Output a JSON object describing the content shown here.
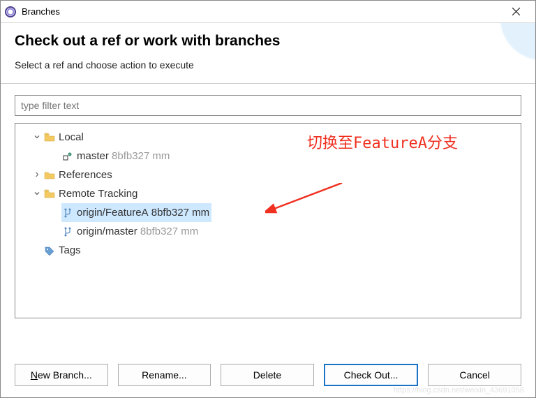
{
  "window": {
    "title": "Branches"
  },
  "header": {
    "title": "Check out a ref or work with branches",
    "subtitle": "Select a ref and choose action to execute"
  },
  "filter": {
    "placeholder": "type filter text"
  },
  "tree": {
    "local": {
      "label": "Local",
      "master": {
        "name": "master",
        "hash": "8bfb327",
        "msg": "mm"
      }
    },
    "references": {
      "label": "References"
    },
    "remote": {
      "label": "Remote Tracking",
      "featureA": {
        "name": "origin/FeatureA",
        "hash": "8bfb327",
        "msg": "mm"
      },
      "master": {
        "name": "origin/master",
        "hash": "8bfb327",
        "msg": "mm"
      }
    },
    "tags": {
      "label": "Tags"
    }
  },
  "annotation": {
    "text": "切换至FeatureA分支"
  },
  "buttons": {
    "newBranch": "New Branch...",
    "rename": "Rename...",
    "delete": "Delete",
    "checkout": "Check Out...",
    "cancel": "Cancel"
  },
  "watermark": "https://blog.csdn.net/weixin_43691058"
}
